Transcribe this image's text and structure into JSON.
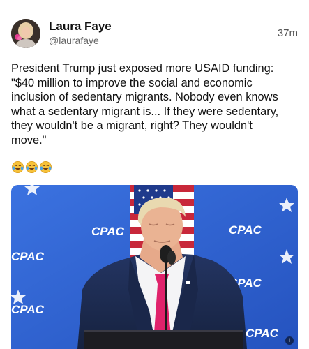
{
  "post": {
    "author_name": "Laura Faye",
    "author_handle": "@laurafaye",
    "timestamp": "37m",
    "text_lines": [
      "President Trump just exposed more USAID funding:",
      "\"$40 million to improve the social and economic",
      "inclusion of sedentary migrants. Nobody even knows",
      "what a sedentary migrant is... If they were sedentary,",
      "they wouldn't be a migrant, right? They wouldn't",
      "move.\""
    ],
    "emoji_icons": [
      "laughing-tears-icon",
      "laughing-tears-icon",
      "laughing-tears-icon"
    ]
  },
  "media": {
    "backdrop_logo_text": "CPAC",
    "badge_text": "i"
  },
  "colors": {
    "backdrop_blue": "#2f63d4",
    "suit_navy": "#1d2b4f",
    "tie_pink": "#e0226b"
  }
}
